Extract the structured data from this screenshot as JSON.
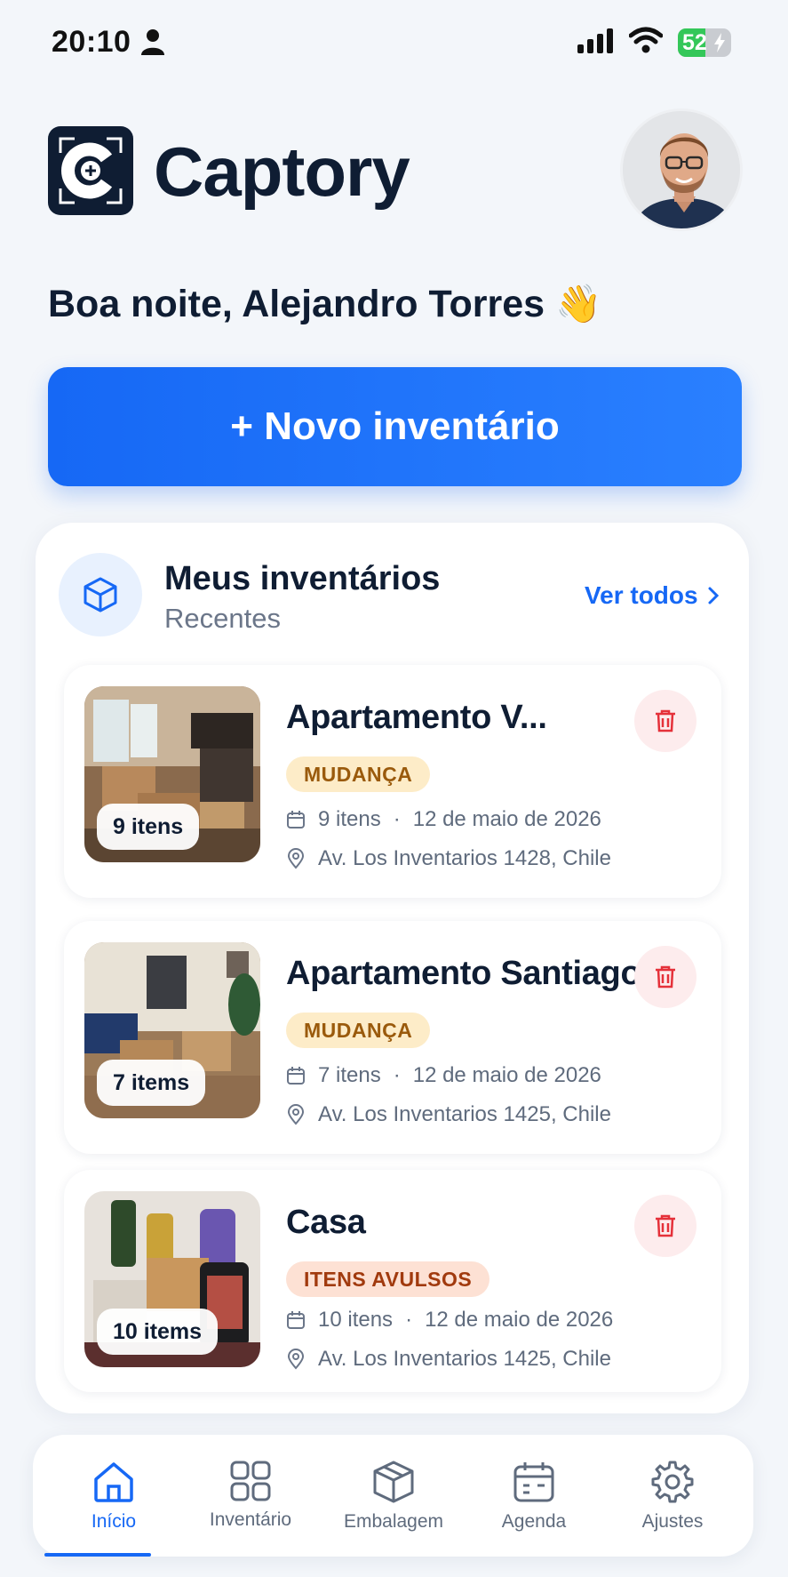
{
  "status_bar": {
    "time": "20:10",
    "battery": "52",
    "battery_level": 0.52
  },
  "header": {
    "app_name": "Captory",
    "logo_icon": "captory-logo-icon",
    "avatar": "user-avatar"
  },
  "greeting": {
    "text": "Boa noite, Alejandro Torres",
    "emoji": "👋"
  },
  "new_inventory_button": "+ Novo inventário",
  "inventories": {
    "title": "Meus inventários",
    "subtitle": "Recentes",
    "see_all": "Ver todos",
    "items": [
      {
        "title": "Apartamento V...",
        "tag": "MUDANÇA",
        "badge": "9 itens",
        "count": "9 itens",
        "date": "12 de maio de 2026",
        "address": "Av. Los Inventarios 1428, Chile"
      },
      {
        "title": "Apartamento Santiago",
        "tag": "MUDANÇA",
        "badge": "7 items",
        "count": "7 itens",
        "date": "12 de maio de 2026",
        "address": "Av. Los Inventarios 1425, Chile"
      },
      {
        "title": "Casa",
        "tag": "ITENS AVULSOS",
        "badge": "10 items",
        "count": "10 itens",
        "date": "12 de maio de 2026",
        "address": "Av. Los Inventarios 1425, Chile"
      }
    ]
  },
  "bottom_nav": [
    {
      "label": "Início",
      "icon": "home-icon",
      "active": true
    },
    {
      "label": "Inventário",
      "icon": "grid-icon",
      "active": false
    },
    {
      "label": "Embalagem",
      "icon": "box-icon",
      "active": false
    },
    {
      "label": "Agenda",
      "icon": "calendar-icon",
      "active": false
    },
    {
      "label": "Ajustes",
      "icon": "gear-icon",
      "active": false
    }
  ],
  "colors": {
    "accent": "#1668f5",
    "navy": "#0f1d33",
    "tag_move_bg": "#fdecc8",
    "tag_loose_bg": "#fde1d4",
    "delete": "#e5313a"
  }
}
